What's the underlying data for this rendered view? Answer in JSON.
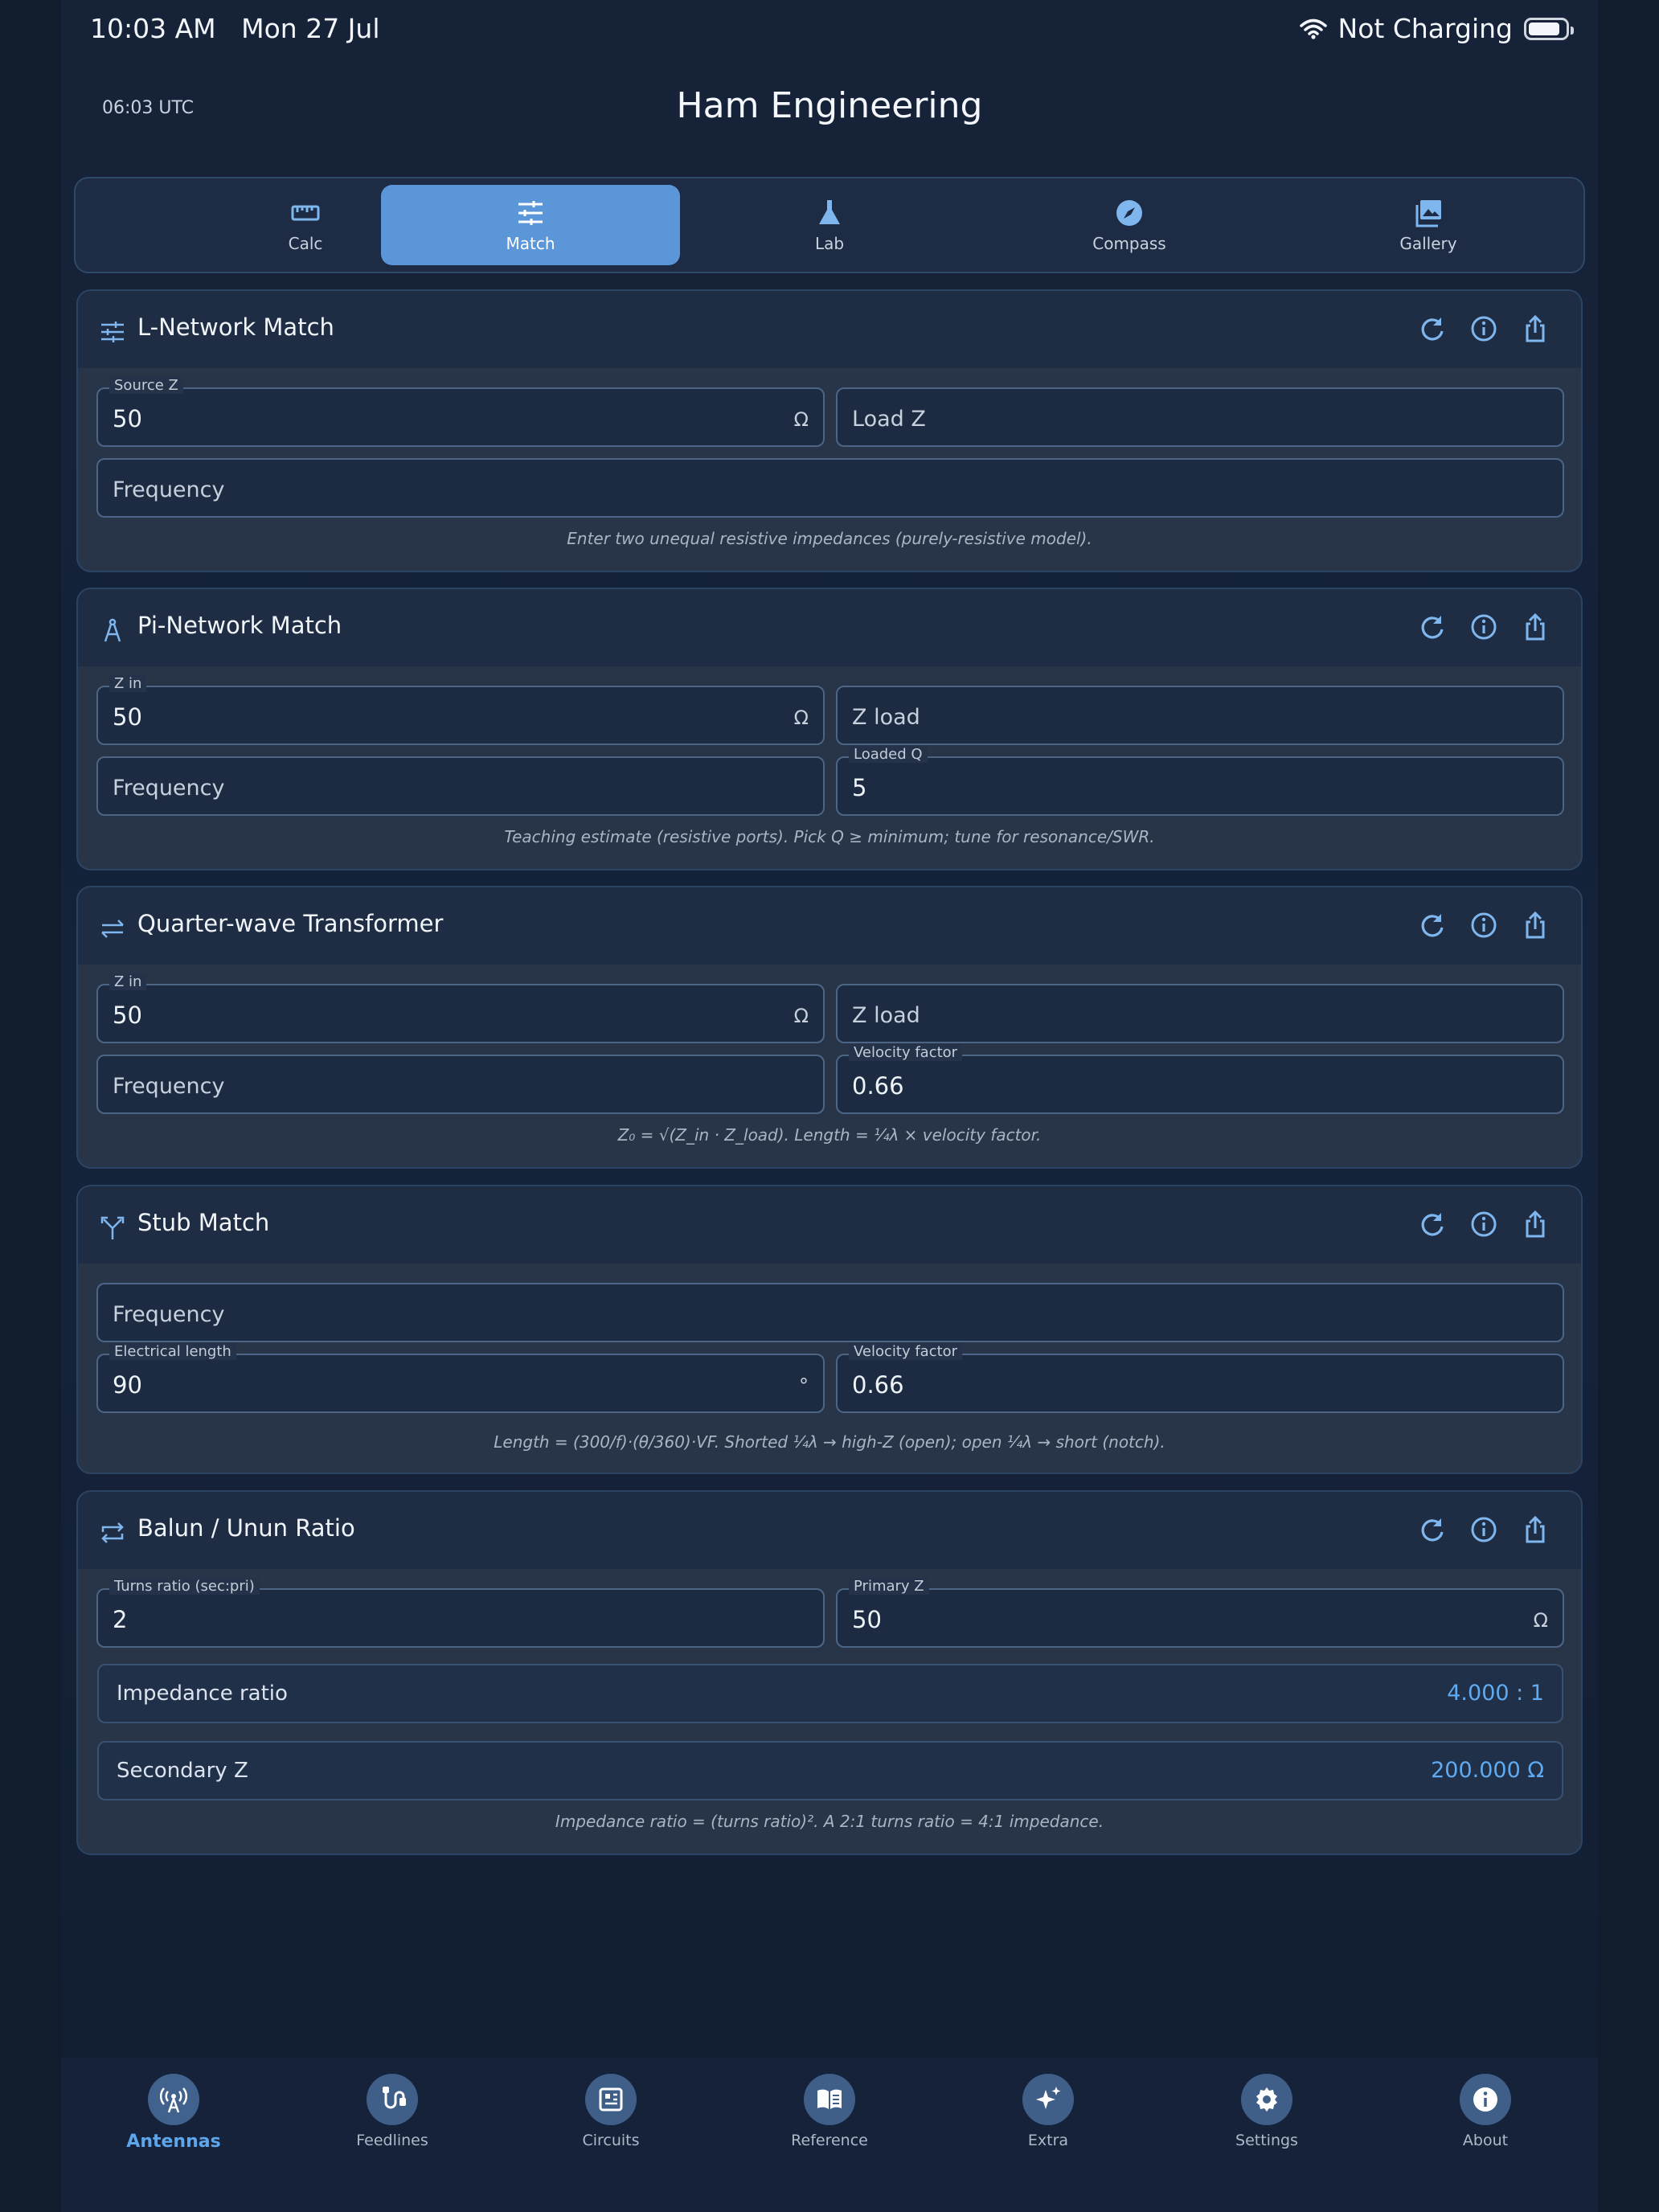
{
  "status_bar": {
    "time": "10:03 AM",
    "date": "Mon 27 Jul",
    "charging": "Not Charging"
  },
  "header": {
    "utc": "06:03 UTC",
    "title": "Ham Engineering"
  },
  "tabs": [
    {
      "label": "Calc",
      "icon": "ruler-icon"
    },
    {
      "label": "Match",
      "icon": "sliders-icon",
      "active": true
    },
    {
      "label": "Lab",
      "icon": "flask-icon"
    },
    {
      "label": "Compass",
      "icon": "compass-icon"
    },
    {
      "label": "Gallery",
      "icon": "gallery-icon"
    }
  ],
  "cards": {
    "lnetwork": {
      "title": "L-Network Match",
      "source_z_label": "Source Z",
      "source_z_value": "50",
      "source_z_unit": "Ω",
      "load_z_placeholder": "Load Z",
      "frequency_placeholder": "Frequency",
      "note": "Enter two unequal resistive impedances (purely-resistive model)."
    },
    "pinetwork": {
      "title": "Pi-Network Match",
      "zin_label": "Z in",
      "zin_value": "50",
      "zin_unit": "Ω",
      "zload_placeholder": "Z load",
      "frequency_placeholder": "Frequency",
      "q_label": "Loaded Q",
      "q_value": "5",
      "note": "Teaching estimate (resistive ports). Pick Q ≥ minimum; tune for resonance/SWR."
    },
    "quarterwave": {
      "title": "Quarter-wave Transformer",
      "zin_label": "Z in",
      "zin_value": "50",
      "zin_unit": "Ω",
      "zload_placeholder": "Z load",
      "frequency_placeholder": "Frequency",
      "vf_label": "Velocity factor",
      "vf_value": "0.66",
      "note": "Z₀ = √(Z_in · Z_load). Length = ¼λ × velocity factor."
    },
    "stub": {
      "title": "Stub Match",
      "frequency_placeholder": "Frequency",
      "elen_label": "Electrical length",
      "elen_value": "90",
      "elen_unit": "°",
      "vf_label": "Velocity factor",
      "vf_value": "0.66",
      "note": "Length = (300/f)·(θ/360)·VF. Shorted ¼λ → high-Z (open); open ¼λ → short (notch)."
    },
    "balun": {
      "title": "Balun / Unun Ratio",
      "turns_label": "Turns ratio (sec:pri)",
      "turns_value": "2",
      "primary_label": "Primary Z",
      "primary_value": "50",
      "primary_unit": "Ω",
      "ratio_label": "Impedance ratio",
      "ratio_value": "4.000 : 1",
      "secondary_label": "Secondary Z",
      "secondary_value": "200.000 Ω",
      "note": "Impedance ratio = (turns ratio)². A 2:1 turns ratio = 4:1 impedance."
    }
  },
  "bottom_nav": [
    {
      "label": "Antennas",
      "icon": "antenna-icon",
      "active": true
    },
    {
      "label": "Feedlines",
      "icon": "feedline-icon"
    },
    {
      "label": "Circuits",
      "icon": "circuit-icon"
    },
    {
      "label": "Reference",
      "icon": "book-icon"
    },
    {
      "label": "Extra",
      "icon": "sparkle-icon"
    },
    {
      "label": "Settings",
      "icon": "gear-icon"
    },
    {
      "label": "About",
      "icon": "info-icon"
    }
  ],
  "colors": {
    "accent": "#5b97d8",
    "result_value": "#5faaf0",
    "background": "#14223a"
  }
}
